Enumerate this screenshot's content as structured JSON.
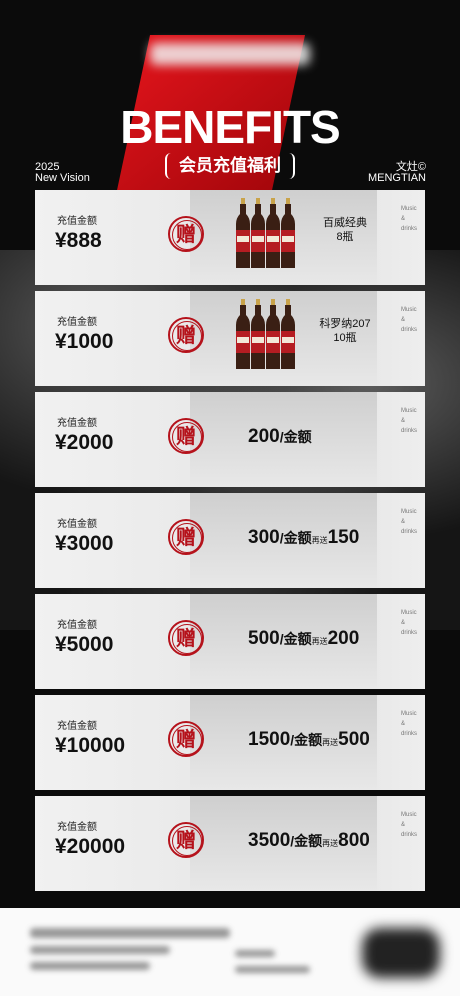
{
  "header": {
    "title": "BENEFITS",
    "subtitle": "会员充值福利",
    "year": "2025",
    "vision": "New Vision",
    "mark_top": "文灶©",
    "mark_bottom": "MENGTIAN"
  },
  "colors": {
    "accent": "#b5121b",
    "background": "#0b0b0b"
  },
  "cards": [
    {
      "label": "充值金额",
      "amount": "¥888",
      "badge": "赠",
      "reward_type": "bottles",
      "reward_name": "百威经典",
      "reward_qty": "8瓶",
      "tag1": "Music",
      "tag2": "&",
      "tag3": "drinks"
    },
    {
      "label": "充值金额",
      "amount": "¥1000",
      "badge": "赠",
      "reward_type": "bottles",
      "reward_name": "科罗纳207",
      "reward_qty": "10瓶",
      "tag1": "Music",
      "tag2": "&",
      "tag3": "drinks"
    },
    {
      "label": "充值金额",
      "amount": "¥2000",
      "badge": "赠",
      "reward_type": "credit",
      "credit": "200",
      "credit_unit": "/金额",
      "extra_label": "",
      "extra": "",
      "tag1": "Music",
      "tag2": "&",
      "tag3": "drinks"
    },
    {
      "label": "充值金额",
      "amount": "¥3000",
      "badge": "赠",
      "reward_type": "credit",
      "credit": "300",
      "credit_unit": "/金额",
      "extra_label": "再送",
      "extra": "150",
      "tag1": "Music",
      "tag2": "&",
      "tag3": "drinks"
    },
    {
      "label": "充值金额",
      "amount": "¥5000",
      "badge": "赠",
      "reward_type": "credit",
      "credit": "500",
      "credit_unit": "/金额",
      "extra_label": "再送",
      "extra": "200",
      "tag1": "Music",
      "tag2": "&",
      "tag3": "drinks"
    },
    {
      "label": "充值金额",
      "amount": "¥10000",
      "badge": "赠",
      "reward_type": "credit",
      "credit": "1500",
      "credit_unit": "/金额",
      "extra_label": "再送",
      "extra": "500",
      "tag1": "Music",
      "tag2": "&",
      "tag3": "drinks"
    },
    {
      "label": "充值金额",
      "amount": "¥20000",
      "badge": "赠",
      "reward_type": "credit",
      "credit": "3500",
      "credit_unit": "/金额",
      "extra_label": "再送",
      "extra": "800",
      "tag1": "Music",
      "tag2": "&",
      "tag3": "drinks"
    }
  ]
}
